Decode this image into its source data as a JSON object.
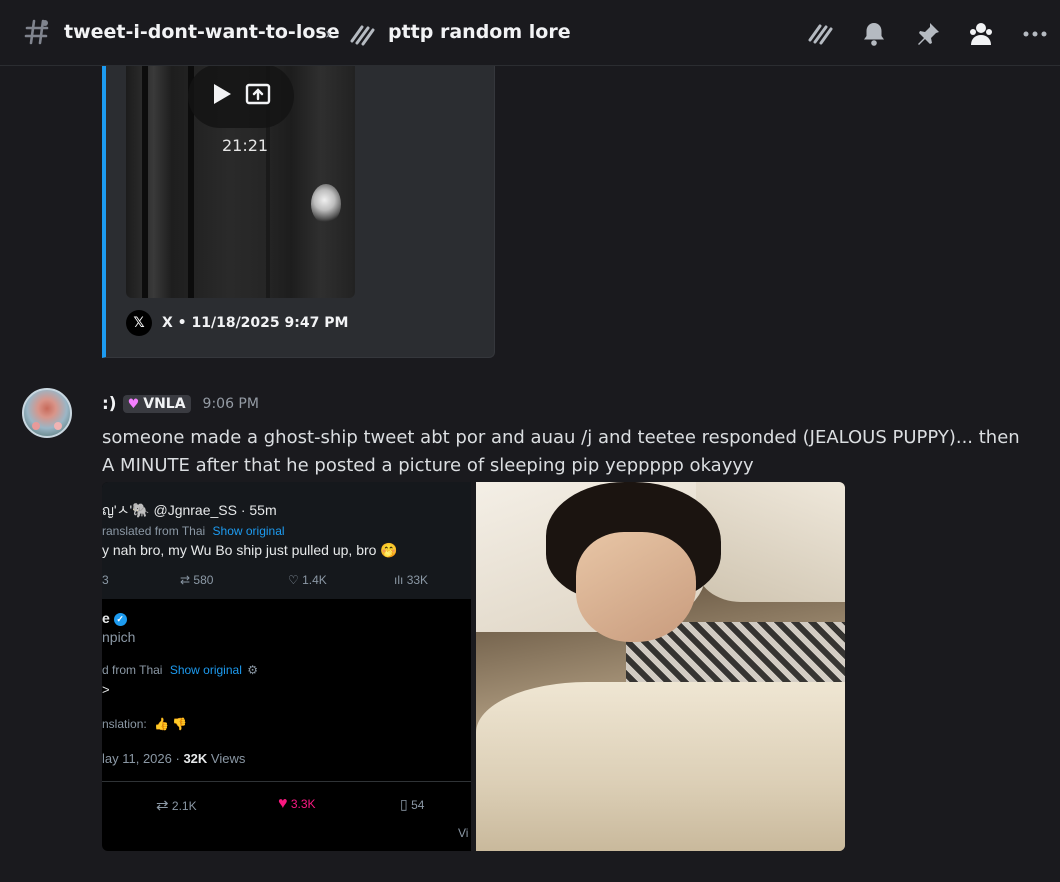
{
  "header": {
    "channel_name": "tweet-i-dont-want-to-lose",
    "thread_name": "pttp random lore"
  },
  "embed": {
    "video_duration": "21:21",
    "footer_provider": "X",
    "footer_text": "X • 11/18/2025 9:47 PM"
  },
  "message": {
    "username": ":)",
    "tag": "VNLA",
    "timestamp": "9:06 PM",
    "text": "someone made a ghost-ship tweet abt por and auau /j and teetee responded (JEALOUS PUPPY)... then A MINUTE after that he posted a picture of sleeping pip yeppppp okayyy"
  },
  "tweet_screenshot": {
    "handle_line": "ญ'ㅅ'🐘 @Jgnrae_SS · 55m",
    "translated_line": "ranslated from Thai",
    "show_original": "Show original",
    "tweet_text": "y nah bro, my Wu Bo ship just pulled up, bro 🤭",
    "stats": [
      "3",
      "580",
      "1.4K",
      "33K"
    ],
    "reply_name": "e",
    "reply_handle": "npich",
    "reply_translated": "d from Thai",
    "reply_show_original": "Show original",
    "reply_body": ">",
    "translation_rate": "nslation:",
    "date_line": "lay 11, 2026 ·",
    "views_count": "32K",
    "views_label": "Views",
    "actions": [
      "2.1K",
      "3.3K",
      "54"
    ],
    "cut_text": "Vi"
  },
  "colors": {
    "background": "#1a1a1e",
    "embed_bar": "#1d9bf0",
    "tag_heart": "#f47fff",
    "like_pink": "#f91880"
  }
}
